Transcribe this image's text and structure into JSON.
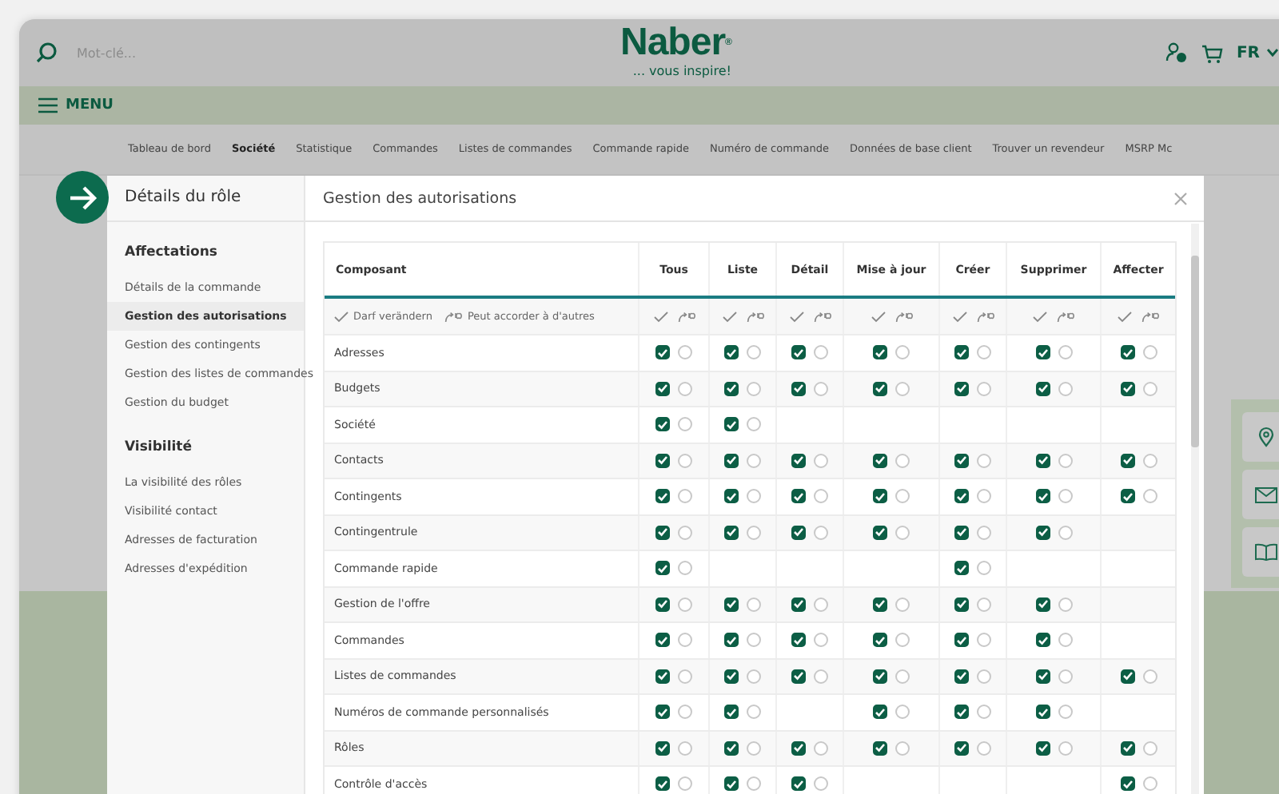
{
  "header": {
    "search_placeholder": "Mot-clé...",
    "logo": "Naber$^{®}$",
    "tagline": "... vous inspire!",
    "language": "FR"
  },
  "menu": {
    "label": "MENU"
  },
  "nav": [
    {
      "label": "Tableau de bord",
      "selected": false
    },
    {
      "label": "Société",
      "selected": true
    },
    {
      "label": "Statistique",
      "selected": false
    },
    {
      "label": "Commandes",
      "selected": false
    },
    {
      "label": "Listes de commandes",
      "selected": false
    },
    {
      "label": "Commande rapide",
      "selected": false
    },
    {
      "label": "Numéro de commande",
      "selected": false
    },
    {
      "label": "Données de base client",
      "selected": false
    },
    {
      "label": "Trouver un revendeur",
      "selected": false
    },
    {
      "label": "MSRP Mc",
      "selected": false
    }
  ],
  "modal": {
    "sidebar": {
      "title": "Détails du rôle",
      "sections": [
        {
          "title": "Affectations",
          "items": [
            {
              "label": "Détails de la commande",
              "selected": false
            },
            {
              "label": "Gestion des autorisations",
              "selected": true
            },
            {
              "label": "Gestion des contingents",
              "selected": false
            },
            {
              "label": "Gestion des listes de commandes",
              "selected": false
            },
            {
              "label": "Gestion du budget",
              "selected": false
            }
          ]
        },
        {
          "title": "Visibilité",
          "items": [
            {
              "label": "La visibilité des rôles",
              "selected": false
            },
            {
              "label": "Visibilité contact",
              "selected": false
            },
            {
              "label": "Adresses de facturation",
              "selected": false
            },
            {
              "label": "Adresses d'expédition",
              "selected": false
            }
          ]
        }
      ]
    },
    "title": "Gestion des autorisations",
    "table": {
      "columns": [
        "Composant",
        "Tous",
        "Liste",
        "Détail",
        "Mise à jour",
        "Créer",
        "Supprimer",
        "Affecter"
      ],
      "legend": {
        "change": "Darf verändern",
        "grant": "Peut accorder à d'autres"
      },
      "rows": [
        {
          "name": "Adresses",
          "cells": [
            {
              "kind": "pair",
              "can_change": true,
              "can_grant": false
            },
            {
              "kind": "pair",
              "can_change": true,
              "can_grant": false
            },
            {
              "kind": "pair",
              "can_change": true,
              "can_grant": false
            },
            {
              "kind": "pair",
              "can_change": true,
              "can_grant": false
            },
            {
              "kind": "pair",
              "can_change": true,
              "can_grant": false
            },
            {
              "kind": "pair",
              "can_change": true,
              "can_grant": false
            },
            {
              "kind": "pair",
              "can_change": true,
              "can_grant": false
            }
          ]
        },
        {
          "name": "Budgets",
          "cells": [
            {
              "kind": "pair",
              "can_change": true,
              "can_grant": false
            },
            {
              "kind": "pair",
              "can_change": true,
              "can_grant": false
            },
            {
              "kind": "pair",
              "can_change": true,
              "can_grant": false
            },
            {
              "kind": "pair",
              "can_change": true,
              "can_grant": false
            },
            {
              "kind": "pair",
              "can_change": true,
              "can_grant": false
            },
            {
              "kind": "pair",
              "can_change": true,
              "can_grant": false
            },
            {
              "kind": "pair",
              "can_change": true,
              "can_grant": false
            }
          ]
        },
        {
          "name": "Société",
          "cells": [
            {
              "kind": "pair",
              "can_change": true,
              "can_grant": false
            },
            {
              "kind": "pair",
              "can_change": true,
              "can_grant": false
            },
            {
              "kind": "none"
            },
            {
              "kind": "none"
            },
            {
              "kind": "none"
            },
            {
              "kind": "none"
            },
            {
              "kind": "none"
            }
          ]
        },
        {
          "name": "Contacts",
          "cells": [
            {
              "kind": "pair",
              "can_change": true,
              "can_grant": false
            },
            {
              "kind": "pair",
              "can_change": true,
              "can_grant": false
            },
            {
              "kind": "pair",
              "can_change": true,
              "can_grant": false
            },
            {
              "kind": "pair",
              "can_change": true,
              "can_grant": false
            },
            {
              "kind": "pair",
              "can_change": true,
              "can_grant": false
            },
            {
              "kind": "pair",
              "can_change": true,
              "can_grant": false
            },
            {
              "kind": "pair",
              "can_change": true,
              "can_grant": false
            }
          ]
        },
        {
          "name": "Contingents",
          "cells": [
            {
              "kind": "pair",
              "can_change": true,
              "can_grant": false
            },
            {
              "kind": "pair",
              "can_change": true,
              "can_grant": false
            },
            {
              "kind": "pair",
              "can_change": true,
              "can_grant": false
            },
            {
              "kind": "pair",
              "can_change": true,
              "can_grant": false
            },
            {
              "kind": "pair",
              "can_change": true,
              "can_grant": false
            },
            {
              "kind": "pair",
              "can_change": true,
              "can_grant": false
            },
            {
              "kind": "pair",
              "can_change": true,
              "can_grant": false
            }
          ]
        },
        {
          "name": "Contingentrule",
          "cells": [
            {
              "kind": "pair",
              "can_change": true,
              "can_grant": false
            },
            {
              "kind": "pair",
              "can_change": true,
              "can_grant": false
            },
            {
              "kind": "pair",
              "can_change": true,
              "can_grant": false
            },
            {
              "kind": "pair",
              "can_change": true,
              "can_grant": false
            },
            {
              "kind": "pair",
              "can_change": true,
              "can_grant": false
            },
            {
              "kind": "pair",
              "can_change": true,
              "can_grant": false
            },
            {
              "kind": "none"
            }
          ]
        },
        {
          "name": "Commande rapide",
          "cells": [
            {
              "kind": "pair",
              "can_change": true,
              "can_grant": false
            },
            {
              "kind": "none"
            },
            {
              "kind": "none"
            },
            {
              "kind": "none"
            },
            {
              "kind": "pair",
              "can_change": true,
              "can_grant": false
            },
            {
              "kind": "none"
            },
            {
              "kind": "none"
            }
          ]
        },
        {
          "name": "Gestion de l'offre",
          "cells": [
            {
              "kind": "pair",
              "can_change": true,
              "can_grant": false
            },
            {
              "kind": "pair",
              "can_change": true,
              "can_grant": false
            },
            {
              "kind": "pair",
              "can_change": true,
              "can_grant": false
            },
            {
              "kind": "pair",
              "can_change": true,
              "can_grant": false
            },
            {
              "kind": "pair",
              "can_change": true,
              "can_grant": false
            },
            {
              "kind": "pair",
              "can_change": true,
              "can_grant": false
            },
            {
              "kind": "none"
            }
          ]
        },
        {
          "name": "Commandes",
          "cells": [
            {
              "kind": "pair",
              "can_change": true,
              "can_grant": false
            },
            {
              "kind": "pair",
              "can_change": true,
              "can_grant": false
            },
            {
              "kind": "pair",
              "can_change": true,
              "can_grant": false
            },
            {
              "kind": "pair",
              "can_change": true,
              "can_grant": false
            },
            {
              "kind": "pair",
              "can_change": true,
              "can_grant": false
            },
            {
              "kind": "pair",
              "can_change": true,
              "can_grant": false
            },
            {
              "kind": "none"
            }
          ]
        },
        {
          "name": "Listes de commandes",
          "cells": [
            {
              "kind": "pair",
              "can_change": true,
              "can_grant": false
            },
            {
              "kind": "pair",
              "can_change": true,
              "can_grant": false
            },
            {
              "kind": "pair",
              "can_change": true,
              "can_grant": false
            },
            {
              "kind": "pair",
              "can_change": true,
              "can_grant": false
            },
            {
              "kind": "pair",
              "can_change": true,
              "can_grant": false
            },
            {
              "kind": "pair",
              "can_change": true,
              "can_grant": false
            },
            {
              "kind": "pair",
              "can_change": true,
              "can_grant": false
            }
          ]
        },
        {
          "name": "Numéros de commande personnalisés",
          "cells": [
            {
              "kind": "pair",
              "can_change": true,
              "can_grant": false
            },
            {
              "kind": "pair",
              "can_change": true,
              "can_grant": false
            },
            {
              "kind": "none"
            },
            {
              "kind": "pair",
              "can_change": true,
              "can_grant": false
            },
            {
              "kind": "pair",
              "can_change": true,
              "can_grant": false
            },
            {
              "kind": "pair",
              "can_change": true,
              "can_grant": false
            },
            {
              "kind": "none"
            }
          ]
        },
        {
          "name": "Rôles",
          "cells": [
            {
              "kind": "pair",
              "can_change": true,
              "can_grant": false
            },
            {
              "kind": "pair",
              "can_change": true,
              "can_grant": false
            },
            {
              "kind": "pair",
              "can_change": true,
              "can_grant": false
            },
            {
              "kind": "pair",
              "can_change": true,
              "can_grant": false
            },
            {
              "kind": "pair",
              "can_change": true,
              "can_grant": false
            },
            {
              "kind": "pair",
              "can_change": true,
              "can_grant": false
            },
            {
              "kind": "pair",
              "can_change": true,
              "can_grant": false
            }
          ]
        },
        {
          "name": "Contrôle d'accès",
          "cells": [
            {
              "kind": "pair",
              "can_change": true,
              "can_grant": false
            },
            {
              "kind": "pair",
              "can_change": true,
              "can_grant": false
            },
            {
              "kind": "pair",
              "can_change": true,
              "can_grant": false
            },
            {
              "kind": "none"
            },
            {
              "kind": "none"
            },
            {
              "kind": "none"
            },
            {
              "kind": "pair",
              "can_change": true,
              "can_grant": false
            }
          ]
        }
      ]
    }
  }
}
